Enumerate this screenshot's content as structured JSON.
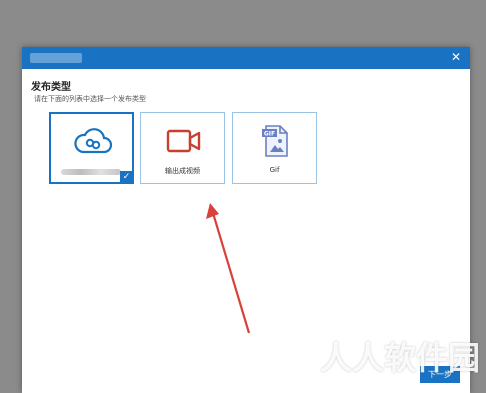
{
  "dialog": {
    "close_icon": "✕",
    "heading": "发布类型",
    "subheading": "请在下面的列表中选择一个发布类型",
    "next_label": "下一步"
  },
  "options": [
    {
      "icon": "cloud-icon",
      "label": "",
      "selected": true
    },
    {
      "icon": "video-camera-icon",
      "label": "输出成视频",
      "selected": false
    },
    {
      "icon": "gif-file-icon",
      "label": "Gif",
      "selected": false
    }
  ],
  "watermark": "人人软件园",
  "colors": {
    "accent": "#1a73c2",
    "video_icon": "#c7402f",
    "annotation_arrow": "#d9413b"
  }
}
